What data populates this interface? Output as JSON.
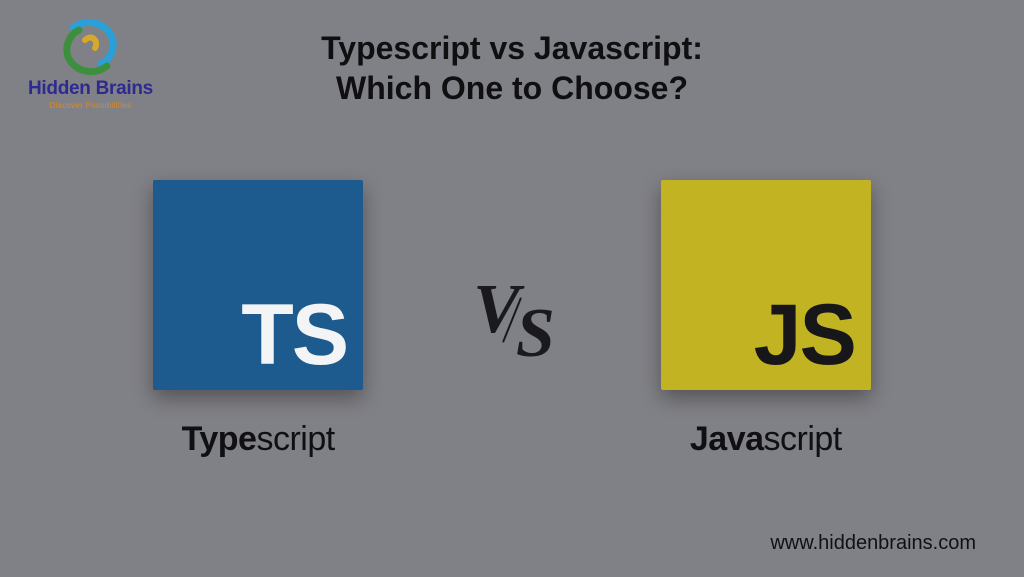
{
  "brand": {
    "name": "Hidden Brains",
    "tagline": "Discover Possibilities"
  },
  "hero": {
    "line1": "Typescript vs Javascript:",
    "line2": "Which One to Choose?"
  },
  "left": {
    "tile_text": "TS",
    "label_bold": "Type",
    "label_light": "script"
  },
  "vs": {
    "v": "V",
    "s": "S"
  },
  "right": {
    "tile_text": "JS",
    "label_bold": "Java",
    "label_light": "script"
  },
  "footer": {
    "url": "www.hiddenbrains.com"
  }
}
